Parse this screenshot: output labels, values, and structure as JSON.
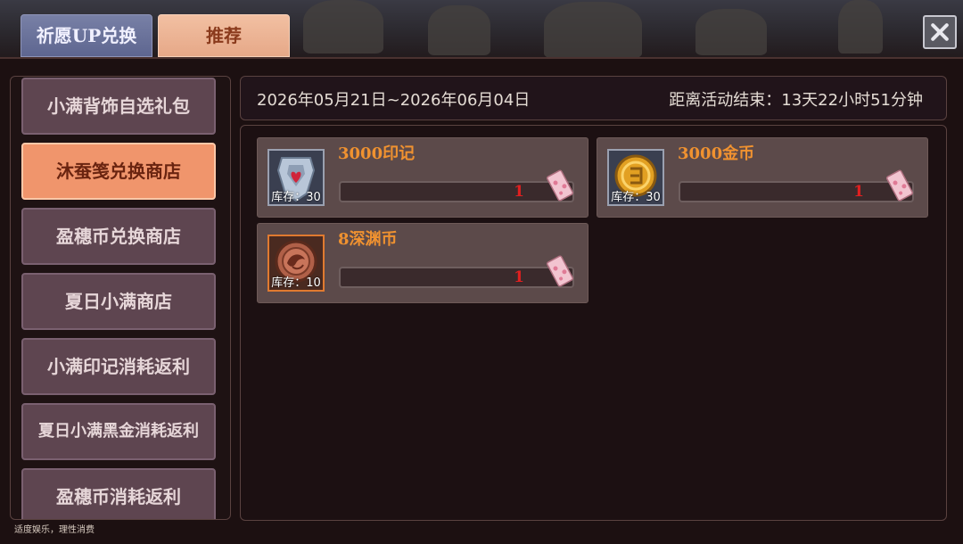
{
  "tabs": {
    "wish_up_exchange": "祈愿UP兑换",
    "recommend": "推荐"
  },
  "sidebar": {
    "items": [
      {
        "label": "小满背饰自选礼包"
      },
      {
        "label": "沐蚕笺兑换商店"
      },
      {
        "label": "盈穗币兑换商店"
      },
      {
        "label": "夏日小满商店"
      },
      {
        "label": "小满印记消耗返利"
      },
      {
        "label": "夏日小满黑金消耗返利"
      },
      {
        "label": "盈穗币消耗返利"
      }
    ],
    "selected_index": 1
  },
  "event": {
    "date_range": "2026年05月21日~2026年06月04日",
    "countdown": "距离活动结束：13天22小时51分钟"
  },
  "shop_items": [
    {
      "title": "3000印记",
      "stock": "库存：30",
      "cost": "1",
      "icon": "mark-badge-icon"
    },
    {
      "title": "3000金币",
      "stock": "库存：30",
      "cost": "1",
      "icon": "gold-coin-icon"
    },
    {
      "title": "8深渊币",
      "stock": "库存：10",
      "cost": "1",
      "icon": "abyss-coin-icon"
    }
  ],
  "footer": {
    "notice": "适度娱乐，理性消费"
  },
  "colors": {
    "accent": "#f09230",
    "selected_tab": "#f0956c",
    "cost_text": "#e02020"
  }
}
